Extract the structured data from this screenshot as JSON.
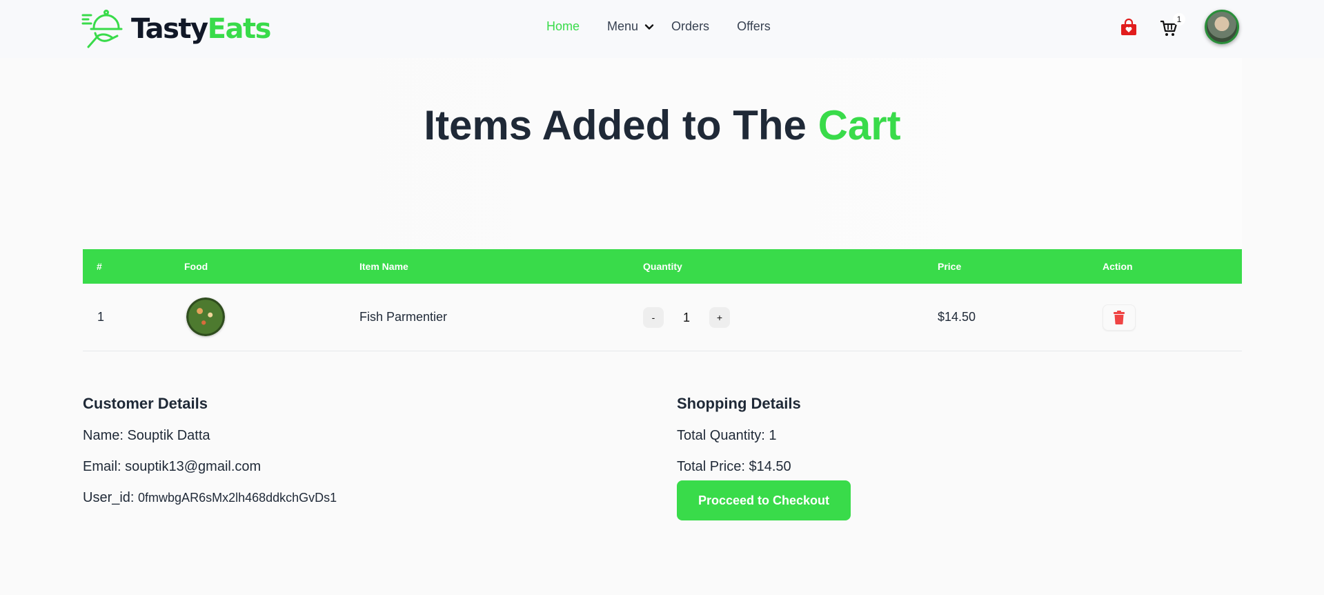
{
  "brand": {
    "name_part1": "Tasty",
    "name_part2": "Eats"
  },
  "nav": {
    "home": "Home",
    "menu": "Menu",
    "orders": "Orders",
    "offers": "Offers"
  },
  "header": {
    "cart_count": "1"
  },
  "hero": {
    "title_main": "Items Added to The ",
    "title_accent": "Cart"
  },
  "table": {
    "headers": [
      "#",
      "Food",
      "Item Name",
      "Quantity",
      "Price",
      "Action"
    ],
    "rows": [
      {
        "index": "1",
        "name": "Fish Parmentier",
        "quantity": "1",
        "price": "$14.50"
      }
    ],
    "minus": "-",
    "plus": "+"
  },
  "customer": {
    "heading": "Customer Details",
    "name": "Name: Souptik Datta",
    "email": "Email: souptik13@gmail.com",
    "uid_label": "User_id: ",
    "uid_value": "0fmwbgAR6sMx2lh468ddkchGvDs1"
  },
  "shopping": {
    "heading": "Shopping Details",
    "total_quantity": "Total Quantity: 1",
    "total_price": "Total Price: $14.50",
    "checkout": "Procceed to Checkout"
  },
  "colors": {
    "accent": "#39db4a",
    "danger": "#ef4444",
    "bag": "#e11d1d"
  },
  "icons": [
    "tasty-eats-logo-icon",
    "chevron-down-icon",
    "shopping-bag-icon",
    "cart-icon",
    "user-avatar",
    "food-thumbnail",
    "trash-icon"
  ]
}
